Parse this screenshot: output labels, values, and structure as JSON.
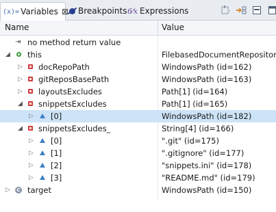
{
  "tabs": [
    {
      "icon": "(x)=",
      "label": "Variables",
      "close": "⊠"
    },
    {
      "label": "Breakpoints"
    },
    {
      "label": "Expressions"
    }
  ],
  "columns": {
    "name": "Name",
    "value": "Value"
  },
  "rows": [
    {
      "name": "no method return value",
      "value": ""
    },
    {
      "name": "this",
      "value": "FilebasedDocumentRepository"
    },
    {
      "name": "docRepoPath",
      "value": "WindowsPath  (id=162)"
    },
    {
      "name": "gitReposBasePath",
      "value": "WindowsPath  (id=163)"
    },
    {
      "name": "layoutsExcludes",
      "value": "Path[1]  (id=164)"
    },
    {
      "name": "snippetsExcludes",
      "value": "Path[1]  (id=165)"
    },
    {
      "name": "[0]",
      "value": "WindowsPath  (id=182)"
    },
    {
      "name": "snippetsExcludes_",
      "value": "String[4]  (id=166)"
    },
    {
      "name": "[0]",
      "value": "\".git\"  (id=175)"
    },
    {
      "name": "[1]",
      "value": "\".gitignore\"  (id=177)"
    },
    {
      "name": "[2]",
      "value": "\"snippets.ini\"  (id=178)"
    },
    {
      "name": "[3]",
      "value": "\"README.md\"  (id=179)"
    },
    {
      "name": "target",
      "value": "WindowsPath  (id=150)"
    }
  ],
  "colors": {
    "selection": "#cde3f7",
    "private": "#d03a3a",
    "local": "#3a9a3a",
    "field": "#3a7fc4"
  }
}
